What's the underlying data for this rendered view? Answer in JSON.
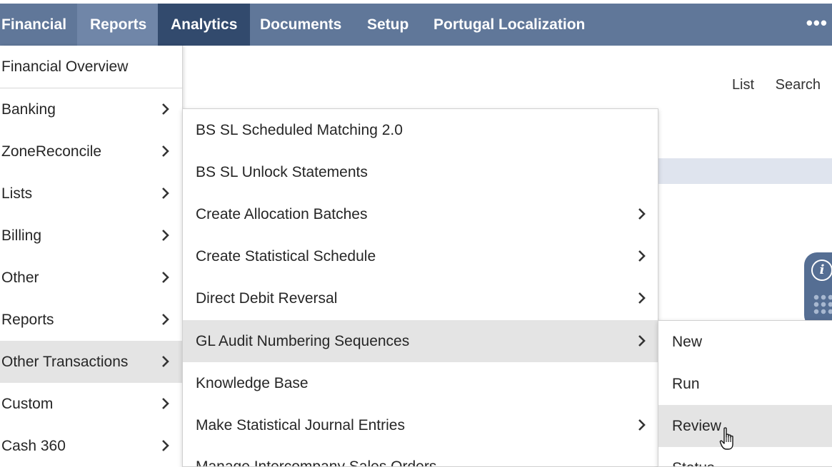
{
  "nav": {
    "tabs": [
      "Financial",
      "Reports",
      "Analytics",
      "Documents",
      "Setup",
      "Portugal Localization"
    ],
    "more_label": "•••"
  },
  "page": {
    "links": [
      "List",
      "Search"
    ]
  },
  "menu1": {
    "header": "Financial Overview",
    "items": [
      "Banking",
      "ZoneReconcile",
      "Lists",
      "Billing",
      "Other",
      "Reports",
      "Other Transactions",
      "Custom",
      "Cash 360"
    ],
    "selected": "Other Transactions"
  },
  "menu2": {
    "items": [
      {
        "label": "BS SL Scheduled Matching 2.0",
        "submenu": false
      },
      {
        "label": "BS SL Unlock Statements",
        "submenu": false
      },
      {
        "label": "Create Allocation Batches",
        "submenu": true
      },
      {
        "label": "Create Statistical Schedule",
        "submenu": true
      },
      {
        "label": "Direct Debit Reversal",
        "submenu": true
      },
      {
        "label": "GL Audit Numbering Sequences",
        "submenu": true
      },
      {
        "label": "Knowledge Base",
        "submenu": false
      },
      {
        "label": "Make Statistical Journal Entries",
        "submenu": true
      },
      {
        "label": "Manage Intercompany Sales Orders",
        "submenu": false
      }
    ],
    "selected": "GL Audit Numbering Sequences"
  },
  "menu3": {
    "items": [
      "New",
      "Run",
      "Review",
      "Status"
    ],
    "hovered": "Review"
  },
  "help_widget": {
    "info_icon": "i"
  },
  "colors": {
    "nav_bg": "#607799",
    "nav_highlight": "#7086a8",
    "nav_active": "#324a6d",
    "menu_selected": "#e4e4e4",
    "page_strip": "#dfe4ee",
    "widget_bg": "#556e93"
  }
}
